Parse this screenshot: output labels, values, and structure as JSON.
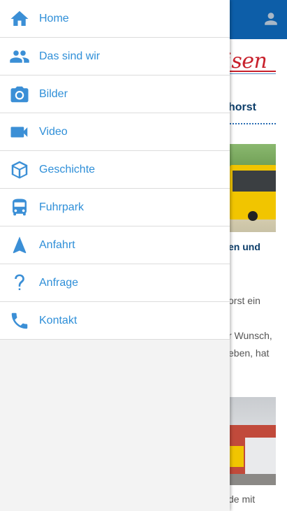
{
  "background_page": {
    "logo_partial": "eisen",
    "section_title_partial": "horst",
    "subheading_partial": "en und",
    "paragraph_lines": [
      "orst ein",
      "r Wunsch,",
      "eben, hat",
      "de mit"
    ]
  },
  "drawer": {
    "items": [
      {
        "label": "Home",
        "icon": "home-icon"
      },
      {
        "label": "Das sind wir",
        "icon": "people-icon"
      },
      {
        "label": "Bilder",
        "icon": "camera-icon"
      },
      {
        "label": "Video",
        "icon": "video-icon"
      },
      {
        "label": "Geschichte",
        "icon": "cube-icon"
      },
      {
        "label": "Fuhrpark",
        "icon": "bus-icon"
      },
      {
        "label": "Anfahrt",
        "icon": "navigation-icon"
      },
      {
        "label": "Anfrage",
        "icon": "question-icon"
      },
      {
        "label": "Kontakt",
        "icon": "phone-icon"
      }
    ]
  },
  "colors": {
    "topbar": "#0d5ea8",
    "menu_accent": "#2f8fd8",
    "logo_red": "#c8202b"
  }
}
